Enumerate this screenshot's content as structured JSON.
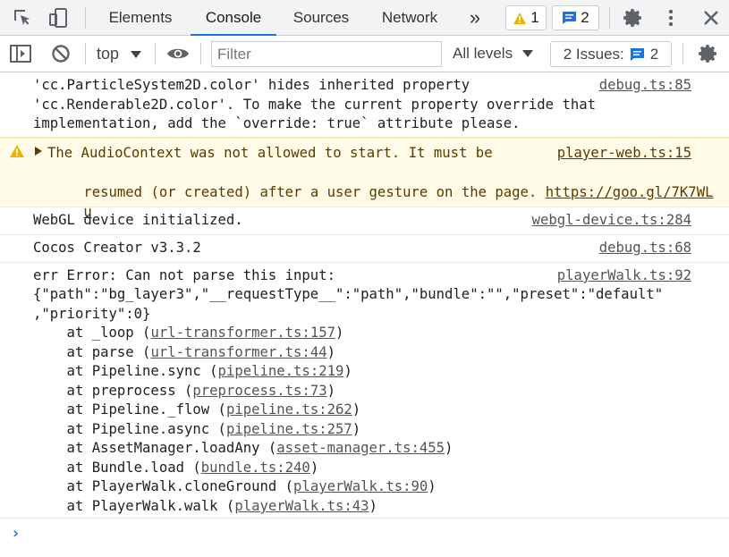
{
  "tabs": [
    {
      "label": "Elements"
    },
    {
      "label": "Console"
    },
    {
      "label": "Sources"
    },
    {
      "label": "Network"
    }
  ],
  "more_tabs_symbol": "»",
  "warnings_badge": {
    "count": "1"
  },
  "messages_badge": {
    "count": "2"
  },
  "toolbar": {
    "context": "top",
    "filter_placeholder": "Filter",
    "levels": "All levels",
    "issues_label": "2 Issues:",
    "issues_count": "2"
  },
  "colors": {
    "accent": "#1a73e8",
    "warning": "#f0b400",
    "warn_bg": "#fffbe6"
  },
  "messages": [
    {
      "type": "log",
      "source": "debug.ts:85",
      "lines": [
        "'cc.ParticleSystem2D.color' hides inherited property",
        "'cc.Renderable2D.color'. To make the current property override that",
        "implementation, add the `override: true` attribute please."
      ]
    },
    {
      "type": "warning",
      "source": "player-web.ts:15",
      "line1": "The AudioContext was not allowed to start. It must be",
      "line2": "resumed (or created) after a user gesture on the page. ",
      "link_a": "https://goo.gl/7K7WL",
      "link_b": "u"
    },
    {
      "type": "log",
      "source": "webgl-device.ts:284",
      "text": "WebGL device initialized."
    },
    {
      "type": "log",
      "source": "debug.ts:68",
      "text": "Cocos Creator v3.3.2"
    },
    {
      "type": "error",
      "source": "playerWalk.ts:92",
      "lines": [
        "err Error: Can not parse this input:",
        "{\"path\":\"bg_layer3\",\"__requestType__\":\"path\",\"bundle\":\"\",\"preset\":\"default\"",
        ",\"priority\":0}"
      ],
      "stack": [
        {
          "fn": "    at _loop (",
          "loc": "url-transformer.ts:157"
        },
        {
          "fn": "    at parse (",
          "loc": "url-transformer.ts:44"
        },
        {
          "fn": "    at Pipeline.sync (",
          "loc": "pipeline.ts:219"
        },
        {
          "fn": "    at preprocess (",
          "loc": "preprocess.ts:73"
        },
        {
          "fn": "    at Pipeline._flow (",
          "loc": "pipeline.ts:262"
        },
        {
          "fn": "    at Pipeline.async (",
          "loc": "pipeline.ts:257"
        },
        {
          "fn": "    at AssetManager.loadAny (",
          "loc": "asset-manager.ts:455"
        },
        {
          "fn": "    at Bundle.load (",
          "loc": "bundle.ts:240"
        },
        {
          "fn": "    at PlayerWalk.cloneGround (",
          "loc": "playerWalk.ts:90"
        },
        {
          "fn": "    at PlayerWalk.walk (",
          "loc": "playerWalk.ts:43"
        }
      ],
      "close_paren": ")"
    }
  ],
  "prompt_symbol": "›"
}
